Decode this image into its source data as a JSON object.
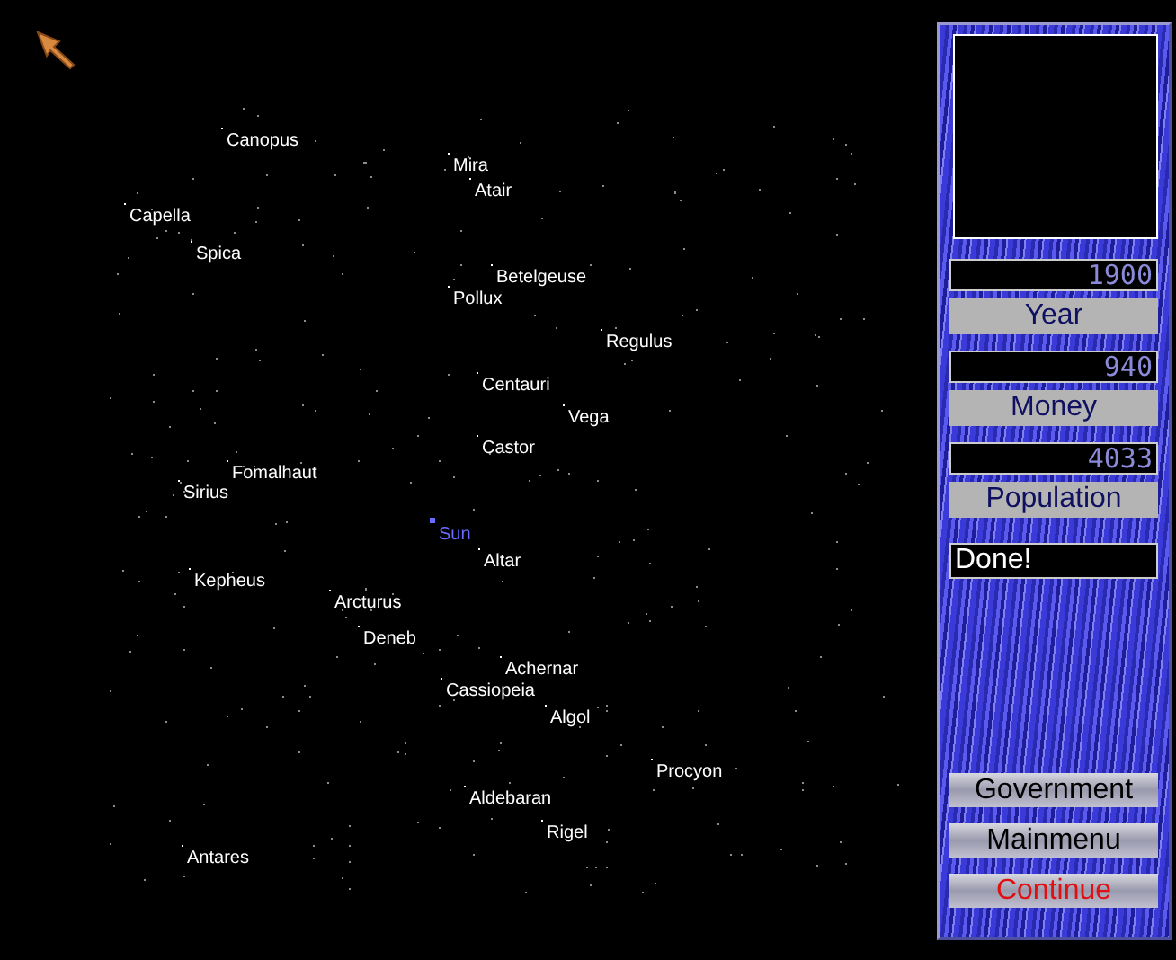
{
  "stars": [
    {
      "name": "Canopus",
      "kind": "star"
    },
    {
      "name": "Mira",
      "kind": "star"
    },
    {
      "name": "Atair",
      "kind": "star"
    },
    {
      "name": "Capella",
      "kind": "star"
    },
    {
      "name": "Spica",
      "kind": "star"
    },
    {
      "name": "Betelgeuse",
      "kind": "star"
    },
    {
      "name": "Pollux",
      "kind": "star"
    },
    {
      "name": "Regulus",
      "kind": "star"
    },
    {
      "name": "Centauri",
      "kind": "star"
    },
    {
      "name": "Vega",
      "kind": "star"
    },
    {
      "name": "Castor",
      "kind": "star"
    },
    {
      "name": "Fomalhaut",
      "kind": "star"
    },
    {
      "name": "Sirius",
      "kind": "star"
    },
    {
      "name": "Sun",
      "kind": "home"
    },
    {
      "name": "Altar",
      "kind": "star"
    },
    {
      "name": "Kepheus",
      "kind": "star"
    },
    {
      "name": "Arcturus",
      "kind": "star"
    },
    {
      "name": "Deneb",
      "kind": "star"
    },
    {
      "name": "Achernar",
      "kind": "star"
    },
    {
      "name": "Cassiopeia",
      "kind": "star"
    },
    {
      "name": "Algol",
      "kind": "star"
    },
    {
      "name": "Procyon",
      "kind": "star"
    },
    {
      "name": "Aldebaran",
      "kind": "star"
    },
    {
      "name": "Rigel",
      "kind": "star"
    },
    {
      "name": "Antares",
      "kind": "star"
    }
  ],
  "panel": {
    "readouts": [
      {
        "value": "1900",
        "label": "Year"
      },
      {
        "value": "940",
        "label": "Money"
      },
      {
        "value": "4033",
        "label": "Population"
      }
    ],
    "status": "Done!",
    "buttons": [
      {
        "label": "Government",
        "kind": "normal"
      },
      {
        "label": "Mainmenu",
        "kind": "normal"
      },
      {
        "label": "Continue",
        "kind": "primary"
      }
    ]
  }
}
